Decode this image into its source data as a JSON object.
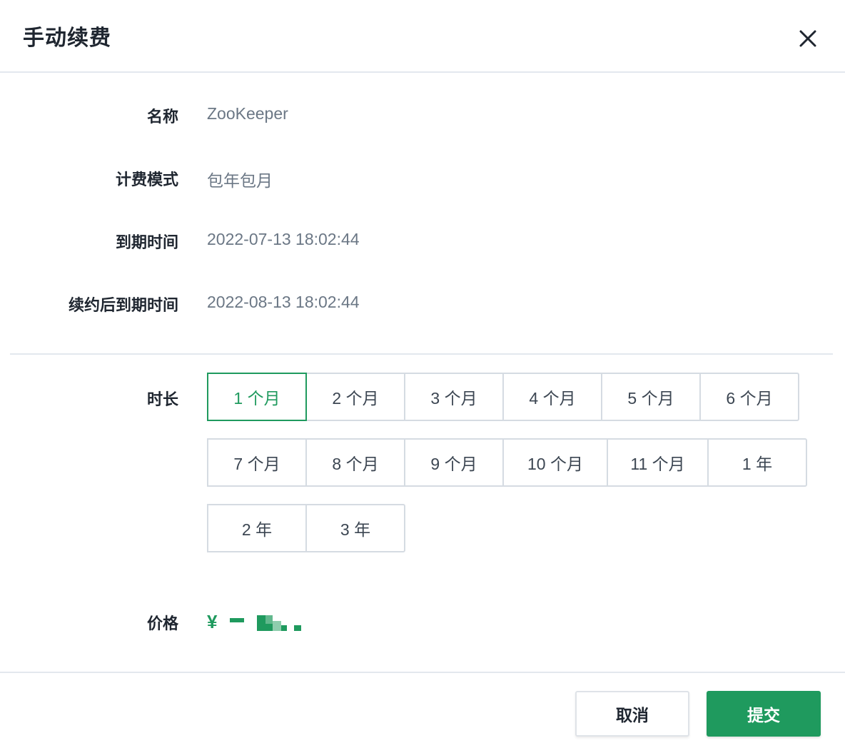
{
  "dialog": {
    "title": "手动续费",
    "close_icon": "close-icon"
  },
  "fields": {
    "name": {
      "label": "名称",
      "value": "ZooKeeper"
    },
    "billing_mode": {
      "label": "计费模式",
      "value": "包年包月"
    },
    "expire_time": {
      "label": "到期时间",
      "value": "2022-07-13 18:02:44"
    },
    "renewed_expire_time": {
      "label": "续约后到期时间",
      "value": "2022-08-13 18:02:44"
    }
  },
  "duration": {
    "label": "时长",
    "selected": "1 个月",
    "options": [
      "1 个月",
      "2 个月",
      "3 个月",
      "4 个月",
      "5 个月",
      "6 个月",
      "7 个月",
      "8 个月",
      "9 个月",
      "10 个月",
      "11 个月",
      "1 年",
      "2 年",
      "3 年"
    ]
  },
  "price": {
    "label": "价格",
    "currency": "¥"
  },
  "footer": {
    "cancel_label": "取消",
    "submit_label": "提交"
  },
  "colors": {
    "accent": "#1f9a5e",
    "border": "#d5dbe2",
    "divider": "#e3e8ee",
    "muted_text": "#6b7785"
  }
}
